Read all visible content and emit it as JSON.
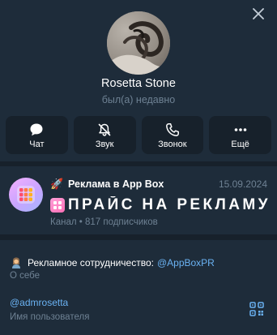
{
  "profile": {
    "name": "Rosetta Stone",
    "status": "был(а) недавно"
  },
  "actions": [
    {
      "label": "Чат",
      "icon": "chat-bubble-icon"
    },
    {
      "label": "Звук",
      "icon": "bell-muted-icon"
    },
    {
      "label": "Звонок",
      "icon": "phone-icon"
    },
    {
      "label": "Ещё",
      "icon": "more-dots-icon"
    }
  ],
  "channel": {
    "title_emoji": "🚀",
    "title": "Реклама в App Box",
    "date": "15.09.2024",
    "message": "ПРАЙС НА РЕКЛАМУ",
    "subtitle": "Канал • 817 подписчиков"
  },
  "bio": {
    "text": "Рекламное сотрудничество:",
    "link": "@AppBoxPR",
    "caption": "О себе"
  },
  "username": {
    "value": "@admrosetta",
    "caption": "Имя пользователя"
  },
  "colors": {
    "background": "#1e2c3a",
    "card": "#17212b",
    "accent": "#6ab2f2",
    "secondary_text": "#6e8193"
  }
}
